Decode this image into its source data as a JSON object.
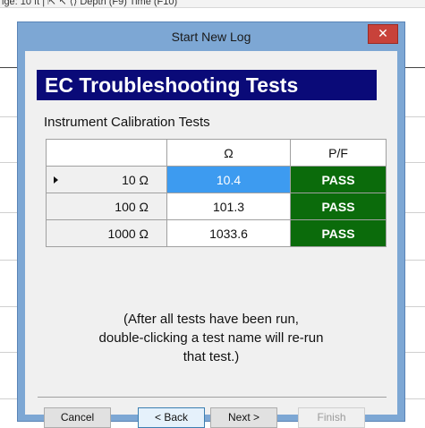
{
  "background_app": {
    "toolbar_text": "ige:  10      ft  |  ⇱  ↖  ⟨⟩   Depth (F9)   Time (F10)"
  },
  "dialog": {
    "title": "Start New Log",
    "close_glyph": "✕",
    "banner": "EC Troubleshooting Tests",
    "section_title": "Instrument Calibration Tests",
    "table": {
      "headers": [
        "",
        "Ω",
        "P/F"
      ],
      "rows": [
        {
          "label": "10 Ω",
          "value": "10.4",
          "result": "PASS"
        },
        {
          "label": "100 Ω",
          "value": "101.3",
          "result": "PASS"
        },
        {
          "label": "1000 Ω",
          "value": "1033.6",
          "result": "PASS"
        }
      ]
    },
    "note_lines": [
      "(After all tests have been run,",
      "double-clicking a test name will re-run",
      "that test.)"
    ],
    "buttons": {
      "cancel": "Cancel",
      "back": "< Back",
      "next": "Next >",
      "finish": "Finish"
    }
  },
  "colors": {
    "banner_bg": "#0a0a78",
    "pass_bg": "#0b6b0b",
    "selected_cell": "#3d9bf0",
    "window_frame": "#7da7d4",
    "close_button": "#c8423a"
  }
}
